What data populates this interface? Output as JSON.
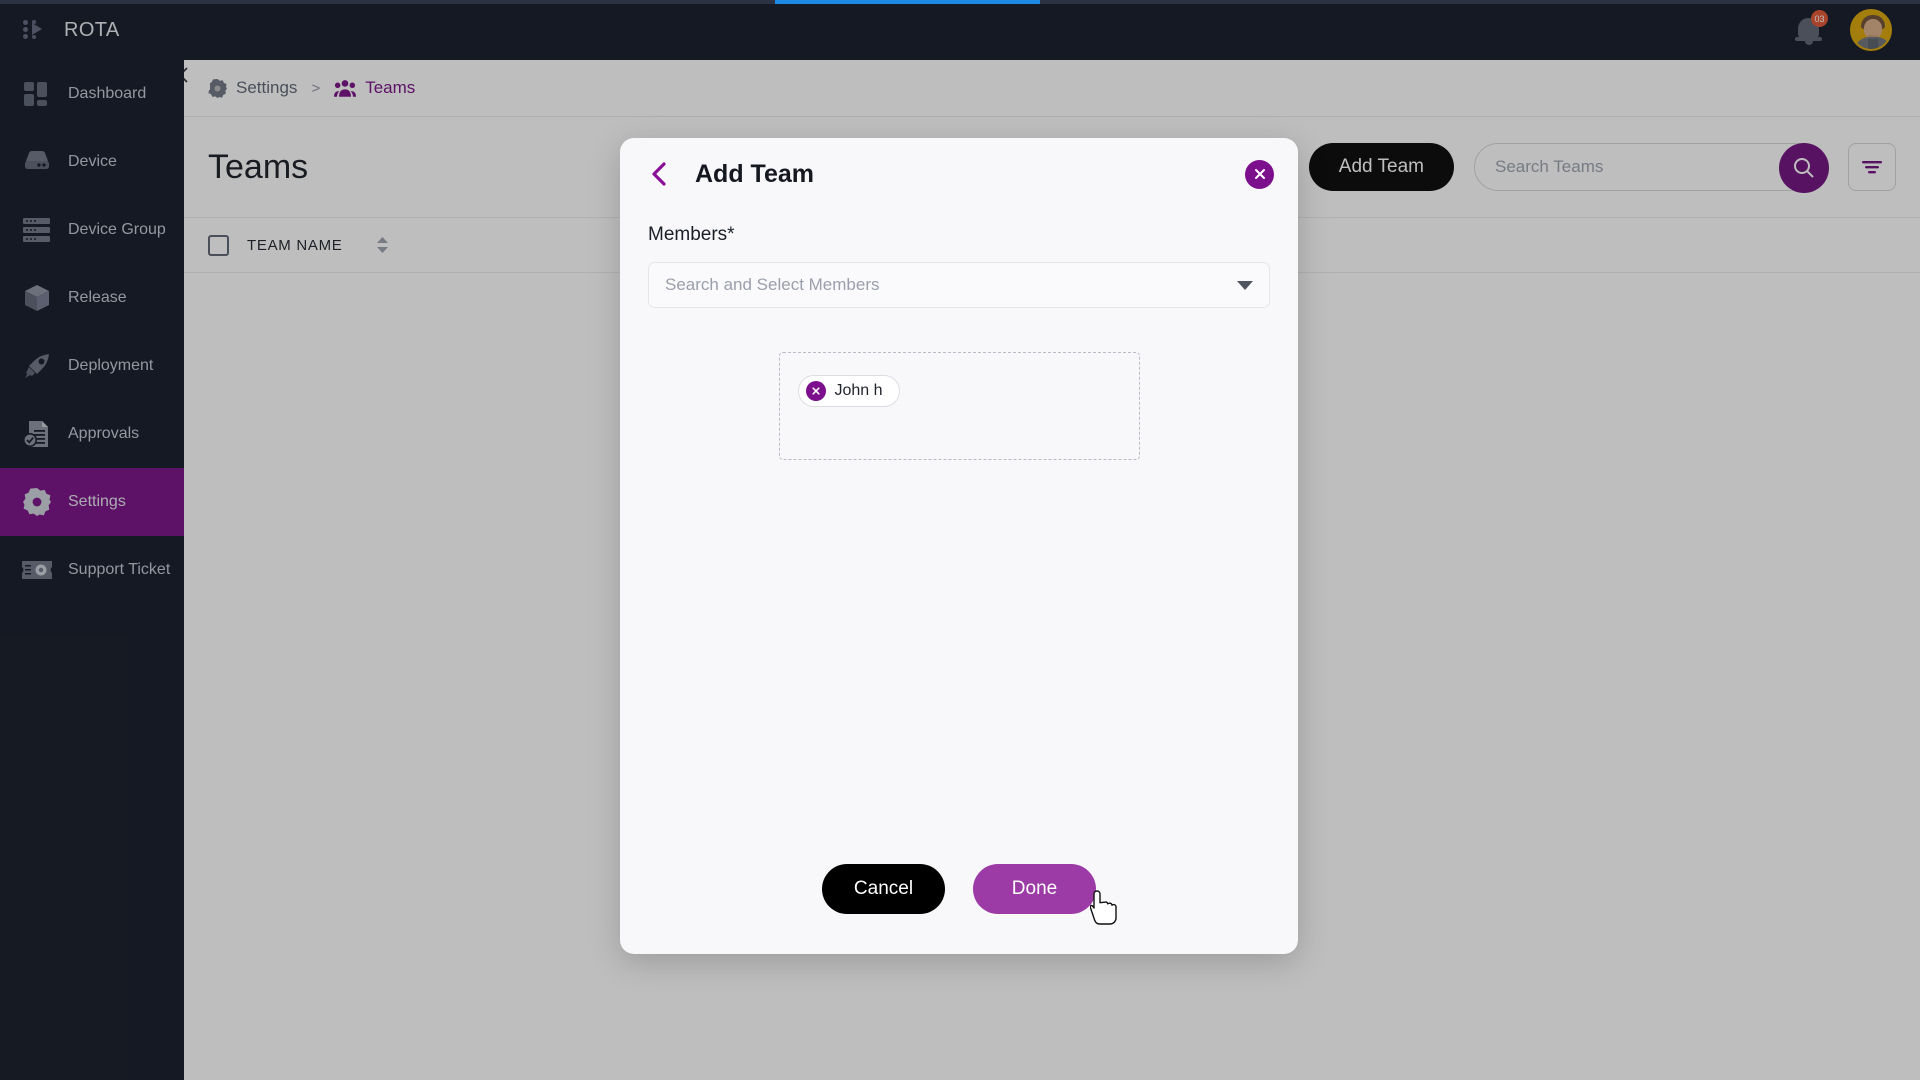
{
  "app": {
    "brand": "ROTA",
    "logo_icon": "rota-dots-logo-icon"
  },
  "topbar": {
    "notification_icon": "bell-icon",
    "notification_count": "03",
    "avatar_icon": "user-avatar"
  },
  "progress": {
    "visible": true,
    "color": "#1e88e5"
  },
  "sidebar": {
    "collapse_icon": "chevron-left-icon",
    "items": [
      {
        "label": "Dashboard",
        "icon": "dashboard-icon",
        "active": false
      },
      {
        "label": "Device",
        "icon": "device-icon",
        "active": false
      },
      {
        "label": "Device Group",
        "icon": "device-group-icon",
        "active": false
      },
      {
        "label": "Release",
        "icon": "release-box-icon",
        "active": false
      },
      {
        "label": "Deployment",
        "icon": "rocket-icon",
        "active": false
      },
      {
        "label": "Approvals",
        "icon": "approvals-doc-icon",
        "active": false
      },
      {
        "label": "Settings",
        "icon": "gear-icon",
        "active": true
      },
      {
        "label": "Support Ticket",
        "icon": "ticket-icon",
        "active": false
      }
    ]
  },
  "breadcrumb": {
    "settings_label": "Settings",
    "settings_icon": "gear-icon",
    "separator": ">",
    "teams_label": "Teams",
    "teams_icon": "people-group-icon"
  },
  "page": {
    "title": "Teams",
    "add_team_label": "Add Team",
    "search_placeholder": "Search Teams",
    "search_value": "",
    "search_icon": "magnifier-icon",
    "filter_icon": "filter-icon"
  },
  "table": {
    "select_all_icon": "checkbox-unchecked",
    "columns": [
      {
        "label": "TEAM NAME",
        "sort_icon": "sort-updown-icon"
      }
    ],
    "rows": []
  },
  "modal": {
    "title": "Add Team",
    "back_icon": "chevron-left-icon",
    "close_icon": "close-x-icon",
    "members_label": "Members*",
    "members_select_placeholder": "Search and Select Members",
    "members_select_value": "",
    "select_caret_icon": "chevron-down-icon",
    "selected_members": [
      {
        "name": "John h",
        "remove_icon": "remove-x-icon"
      }
    ],
    "cancel_label": "Cancel",
    "done_label": "Done"
  },
  "colors": {
    "brand_purple": "#740a83",
    "accent_purple": "#7c0f8c",
    "done_hover_purple": "#9c3ba5",
    "sidebar_bg": "#0d1421",
    "progress_blue": "#1e88e5",
    "badge_red": "#e0512d"
  },
  "cursor": {
    "icon": "pointer-hand-cursor"
  }
}
